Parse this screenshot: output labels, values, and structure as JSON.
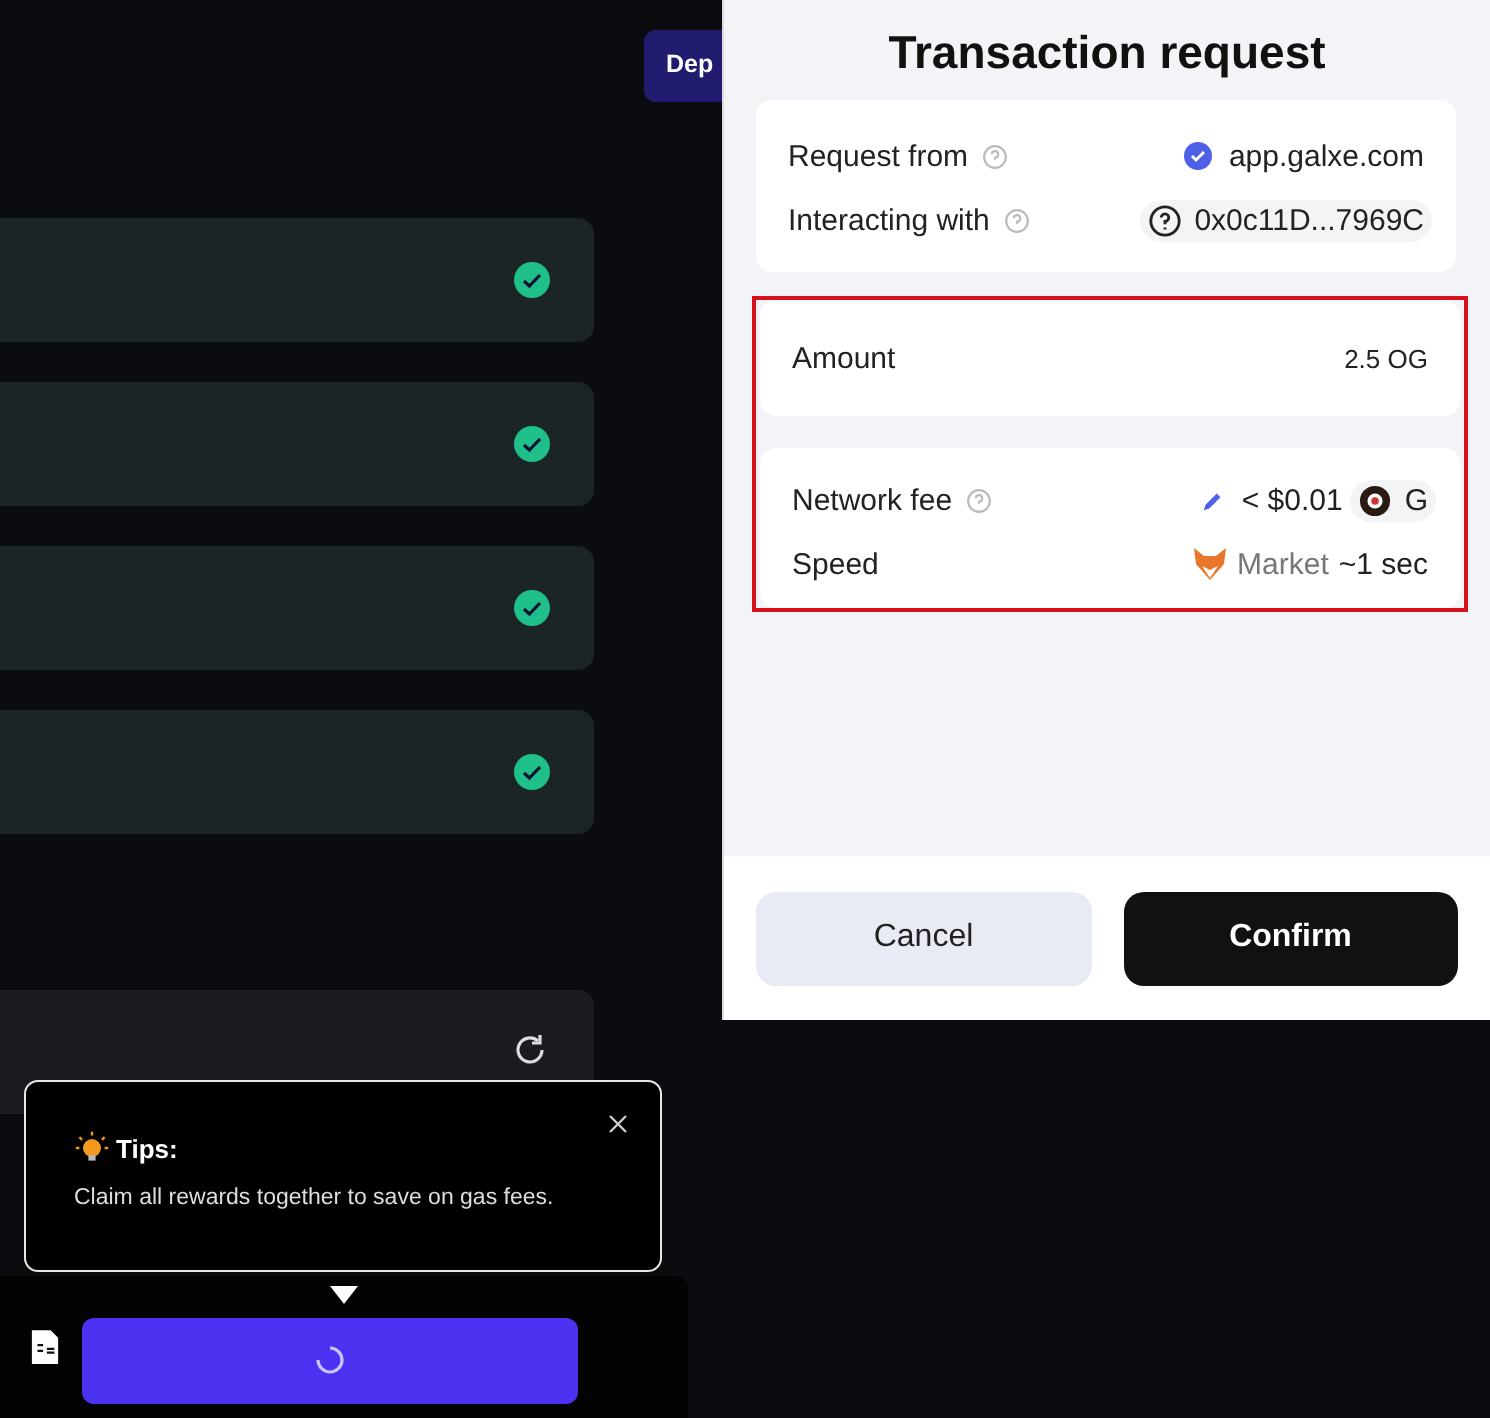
{
  "deposit_button": {
    "label": "Dep"
  },
  "tasks": [
    {
      "completed": true
    },
    {
      "completed": true
    },
    {
      "completed": true
    },
    {
      "completed": true
    }
  ],
  "tips": {
    "title": "Tips:",
    "message": "Claim all rewards together to save on gas fees."
  },
  "claim_button": {
    "loading": true
  },
  "modal": {
    "title": "Transaction request",
    "request_from": {
      "label": "Request from",
      "value": "app.galxe.com"
    },
    "interacting_with": {
      "label": "Interacting with",
      "value": "0x0c11D...7969C"
    },
    "highlighted": true,
    "amount": {
      "label": "Amount",
      "value": "2.5 OG"
    },
    "network_fee": {
      "label": "Network fee",
      "value": "< $0.01",
      "token": "G"
    },
    "speed": {
      "label": "Speed",
      "mode": "Market",
      "time": "~1 sec"
    },
    "buttons": {
      "cancel": "Cancel",
      "confirm": "Confirm"
    }
  }
}
